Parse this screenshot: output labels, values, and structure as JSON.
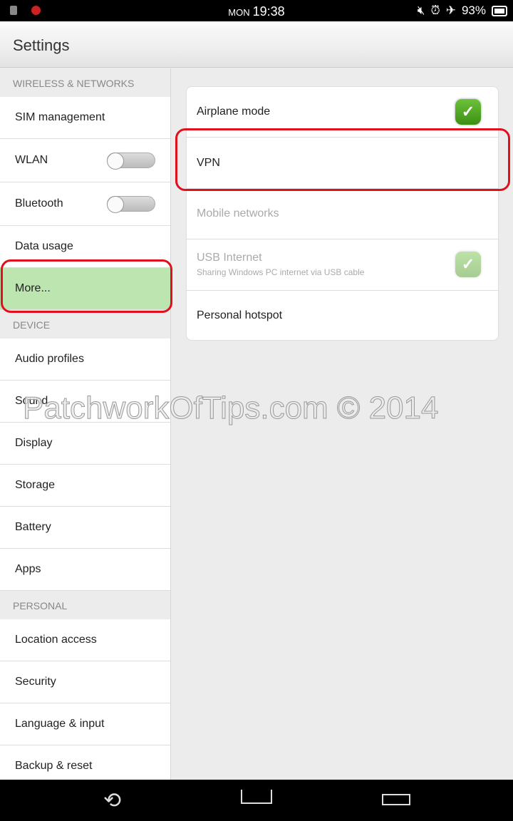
{
  "status_bar": {
    "day": "MON",
    "time": "19:38",
    "battery": "93%",
    "icons": [
      "mute-icon",
      "alarm-icon",
      "airplane-icon",
      "battery-icon"
    ]
  },
  "header": {
    "title": "Settings"
  },
  "sidebar": {
    "sections": [
      {
        "label": "WIRELESS & NETWORKS",
        "items": [
          {
            "label": "SIM management"
          },
          {
            "label": "WLAN",
            "toggle": false
          },
          {
            "label": "Bluetooth",
            "toggle": false
          },
          {
            "label": "Data usage"
          },
          {
            "label": "More...",
            "selected": true
          }
        ]
      },
      {
        "label": "DEVICE",
        "items": [
          {
            "label": "Audio profiles"
          },
          {
            "label": "Sound"
          },
          {
            "label": "Display"
          },
          {
            "label": "Storage"
          },
          {
            "label": "Battery"
          },
          {
            "label": "Apps"
          }
        ]
      },
      {
        "label": "PERSONAL",
        "items": [
          {
            "label": "Location access"
          },
          {
            "label": "Security"
          },
          {
            "label": "Language & input"
          },
          {
            "label": "Backup & reset"
          }
        ]
      }
    ]
  },
  "main": {
    "rows": [
      {
        "label": "Airplane mode",
        "checked": true
      },
      {
        "label": "VPN"
      },
      {
        "label": "Mobile networks",
        "disabled": true
      },
      {
        "label": "USB Internet",
        "summary": "Sharing Windows PC internet via USB cable",
        "disabled": true,
        "checked": true
      },
      {
        "label": "Personal hotspot"
      }
    ]
  },
  "watermark": "PatchworkOfTips.com © 2014",
  "colors": {
    "selected": "#bde5b0",
    "highlight": "#e0101e",
    "check": "#4fa823"
  }
}
